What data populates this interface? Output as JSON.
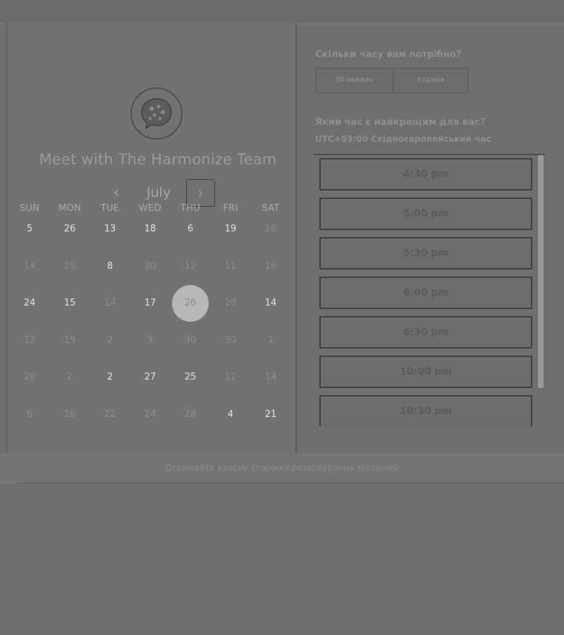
{
  "booking": {
    "title": "Meet with The Harmonize Team",
    "month": "July",
    "prev_symbol": "‹",
    "next_symbol": "›",
    "weekdays": [
      "SUN",
      "MON",
      "TUE",
      "WED",
      "THU",
      "FRI",
      "SAT"
    ],
    "weeks": [
      [
        {
          "d": "5",
          "a": true
        },
        {
          "d": "26",
          "a": true
        },
        {
          "d": "13",
          "a": true
        },
        {
          "d": "18",
          "a": true
        },
        {
          "d": "6",
          "a": true
        },
        {
          "d": "19",
          "a": true
        },
        {
          "d": "16",
          "a": false
        }
      ],
      [
        {
          "d": "14",
          "a": false
        },
        {
          "d": "25",
          "a": false
        },
        {
          "d": "8",
          "a": true
        },
        {
          "d": "30",
          "a": false
        },
        {
          "d": "12",
          "a": false
        },
        {
          "d": "11",
          "a": false
        },
        {
          "d": "16",
          "a": false
        }
      ],
      [
        {
          "d": "24",
          "a": true
        },
        {
          "d": "15",
          "a": true
        },
        {
          "d": "14",
          "a": false
        },
        {
          "d": "17",
          "a": true
        },
        {
          "d": "26",
          "a": false,
          "selected": true
        },
        {
          "d": "20",
          "a": false
        },
        {
          "d": "14",
          "a": true
        }
      ],
      [
        {
          "d": "12",
          "a": false
        },
        {
          "d": "19",
          "a": false
        },
        {
          "d": "2",
          "a": false
        },
        {
          "d": "9",
          "a": false
        },
        {
          "d": "30",
          "a": false
        },
        {
          "d": "30",
          "a": false
        },
        {
          "d": "1",
          "a": false
        }
      ],
      [
        {
          "d": "29",
          "a": false
        },
        {
          "d": "2",
          "a": false
        },
        {
          "d": "2",
          "a": true
        },
        {
          "d": "27",
          "a": true
        },
        {
          "d": "25",
          "a": true
        },
        {
          "d": "12",
          "a": false
        },
        {
          "d": "14",
          "a": false
        }
      ],
      [
        {
          "d": "6",
          "a": false
        },
        {
          "d": "16",
          "a": false
        },
        {
          "d": "22",
          "a": false
        },
        {
          "d": "24",
          "a": false
        },
        {
          "d": "28",
          "a": false
        },
        {
          "d": "4",
          "a": true
        },
        {
          "d": "21",
          "a": true
        }
      ]
    ]
  },
  "scheduler": {
    "duration_question": "Скільки часу вам потрібно?",
    "duration_options": [
      "30 хвилин",
      "година"
    ],
    "time_question": "Який час є найкращим для вас?",
    "timezone": "UTC+03:00 Східноєвропейський час",
    "slots": [
      "4:30 pm",
      "5:00 pm",
      "5:30 pm",
      "6:00 pm",
      "6:30 pm",
      "10:00 pm",
      "10:30 pm"
    ]
  },
  "footer": {
    "text": "Отримайте власну сторінку резервування зустрічей"
  },
  "colors": {
    "selected_day": "#b7b7b7",
    "available_day": "#e2e2e2",
    "unavailable_day": "#8c8c8c"
  },
  "icons": {
    "avatar": "chat-bubble-logo-icon",
    "prev": "chevron-left-icon",
    "next": "chevron-right-icon"
  }
}
